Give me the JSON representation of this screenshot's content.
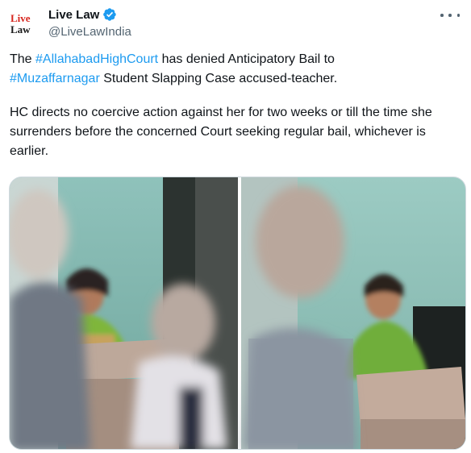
{
  "author": {
    "display_name": "Live Law",
    "handle": "@LiveLawIndia",
    "avatar_logo_lines": [
      "Live",
      "Law"
    ],
    "verified": true,
    "verified_color": "#1d9bf0",
    "logo_color": "#d7261e"
  },
  "tweet": {
    "para1": {
      "t1": "The ",
      "tag1": "#AllahabadHighCourt",
      "t2": " has denied Anticipatory Bail to ",
      "tag2": "#Muzaffarnagar",
      "t3": " Student Slapping Case accused-teacher."
    },
    "para2": "HC directs no coercive action against her for two weeks or till the time she surrenders before the concerned Court seeking regular bail, whichever is earlier."
  },
  "media": {
    "kind": "collage-photo",
    "panels": 2
  },
  "icons": {
    "more": "more-horizontal-icon",
    "verified": "verified-badge-icon"
  },
  "colors": {
    "hashtag": "#1d9bf0",
    "secondary_text": "#536471"
  }
}
